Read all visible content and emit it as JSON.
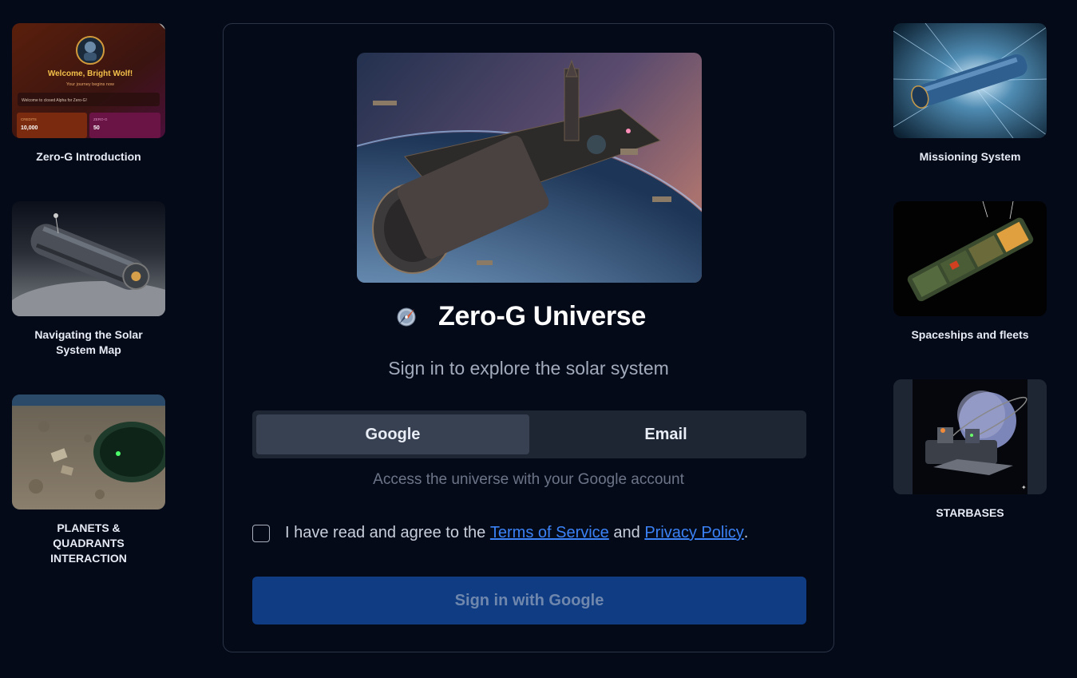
{
  "left_cards": [
    {
      "label": "Zero-G Introduction",
      "thumb": {
        "welcome": "Welcome, Bright Wolf!",
        "tagline": "Your journey begins now",
        "message": "Welcome to closed Alpha for Zero-G!",
        "credits_label": "CREDITS",
        "credits_value": "10,000",
        "zero_g_label": "ZERO-G",
        "zero_g_value": "50"
      }
    },
    {
      "label": "Navigating the Solar System Map"
    },
    {
      "label": "PLANETS & QUADRANTS INTERACTION"
    }
  ],
  "right_cards": [
    {
      "label": "Missioning System"
    },
    {
      "label": "Spaceships and fleets"
    },
    {
      "label": "STARBASES"
    }
  ],
  "login": {
    "title": "Zero-G Universe",
    "subtitle": "Sign in to explore the solar system",
    "tabs": [
      {
        "label": "Google",
        "active": true
      },
      {
        "label": "Email",
        "active": false
      }
    ],
    "access_note": "Access the universe with your Google account",
    "agree": {
      "prefix": "I have read and agree to the",
      "terms": "Terms of Service",
      "middle": "and",
      "privacy": "Privacy Policy",
      "suffix": ".",
      "checked": false
    },
    "signin_button": "Sign in with Google"
  },
  "colors": {
    "background": "#050a18",
    "panel_border": "#2a3446",
    "tab_bar": "#1e2634",
    "active_tab": "#374151",
    "signin_button": "#0f3c83",
    "link": "#3b82f6"
  },
  "icons": {
    "brand": "compass-icon"
  }
}
